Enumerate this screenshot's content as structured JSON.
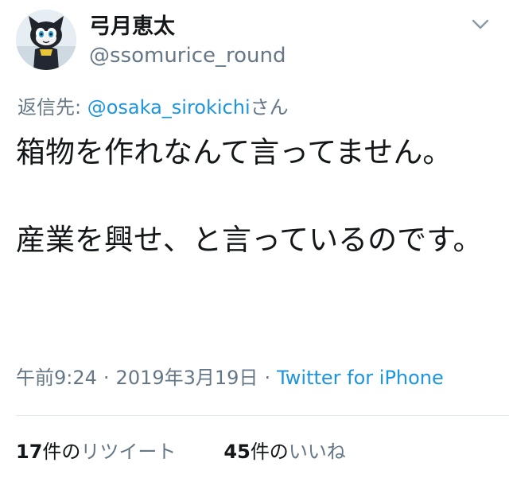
{
  "author": {
    "display_name": "弓月恵太",
    "handle": "@ssomurice_round",
    "avatar_icon": "black-cat-mascot-avatar"
  },
  "reply": {
    "prefix": "返信先: ",
    "mention": "@osaka_sirokichi",
    "suffix": "さん"
  },
  "tweet": {
    "paragraph_1": "箱物を作れなんて言ってません。",
    "paragraph_2": "産業を興せ、と言っているのです。"
  },
  "meta": {
    "time": "午前9:24",
    "separator": "·",
    "date": "2019年3月19日",
    "source": "Twitter for iPhone"
  },
  "stats": {
    "retweets_count": "17",
    "retweets_unit": "件の",
    "retweets_label": "リツイート",
    "likes_count": "45",
    "likes_unit": "件の",
    "likes_label": "いいね"
  },
  "colors": {
    "link": "#1b95e0",
    "secondary_text": "#657786",
    "primary_text": "#14171a",
    "divider": "#e1e8ed"
  }
}
